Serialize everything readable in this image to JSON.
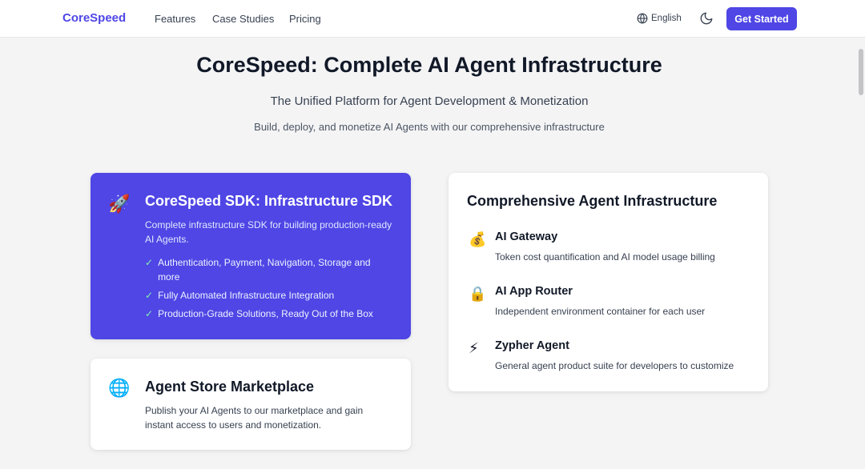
{
  "header": {
    "brand": "CoreSpeed",
    "nav": [
      "Features",
      "Case Studies",
      "Pricing"
    ],
    "language": "English",
    "language_icon": "globe-icon",
    "theme_icon": "moon-icon",
    "cta_label": "Get Started"
  },
  "hero": {
    "title": "CoreSpeed: Complete AI Agent Infrastructure",
    "subtitle": "The Unified Platform for Agent Development & Monetization",
    "description": "Build, deploy, and monetize AI Agents with our comprehensive infrastructure"
  },
  "sdk_card": {
    "icon": "🚀",
    "title": "CoreSpeed SDK: Infrastructure SDK",
    "description": "Complete infrastructure SDK for building production-ready AI Agents.",
    "check_glyph": "✓",
    "features": [
      "Authentication, Payment, Navigation, Storage and more",
      "Fully Automated Infrastructure Integration",
      "Production-Grade Solutions, Ready Out of the Box"
    ]
  },
  "store_card": {
    "icon": "🌐",
    "title": "Agent Store Marketplace",
    "description": "Publish your AI Agents to our marketplace and gain instant access to users and monetization."
  },
  "infra_card": {
    "title": "Comprehensive Agent Infrastructure",
    "items": [
      {
        "icon": "💰",
        "title": "AI Gateway",
        "description": "Token cost quantification and AI model usage billing"
      },
      {
        "icon": "🔒",
        "title": "AI App Router",
        "description": "Independent environment container for each user"
      },
      {
        "icon": "⚡",
        "title": "Zypher Agent",
        "description": "General agent product suite for developers to customize"
      }
    ]
  },
  "colors": {
    "accent": "#4f46e5",
    "background": "#f4f4f5",
    "check": "#86efac"
  }
}
